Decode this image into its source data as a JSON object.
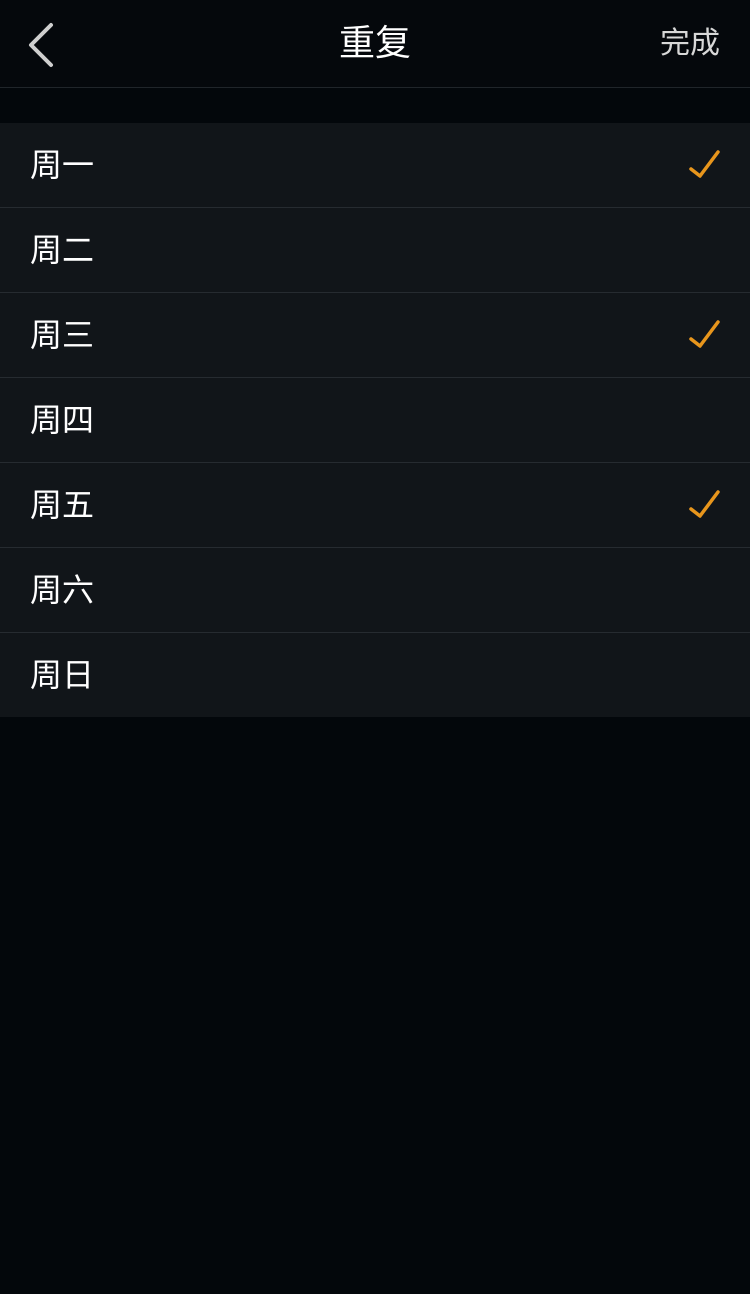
{
  "header": {
    "title": "重复",
    "done_label": "完成",
    "back_icon": "chevron-left-icon"
  },
  "days": [
    {
      "label": "周一",
      "checked": true
    },
    {
      "label": "周二",
      "checked": false
    },
    {
      "label": "周三",
      "checked": true
    },
    {
      "label": "周四",
      "checked": false
    },
    {
      "label": "周五",
      "checked": true
    },
    {
      "label": "周六",
      "checked": false
    },
    {
      "label": "周日",
      "checked": false
    }
  ],
  "colors": {
    "accent": "#e8961c",
    "background": "#03070b",
    "row_background": "#111519",
    "separator": "#262b30"
  }
}
